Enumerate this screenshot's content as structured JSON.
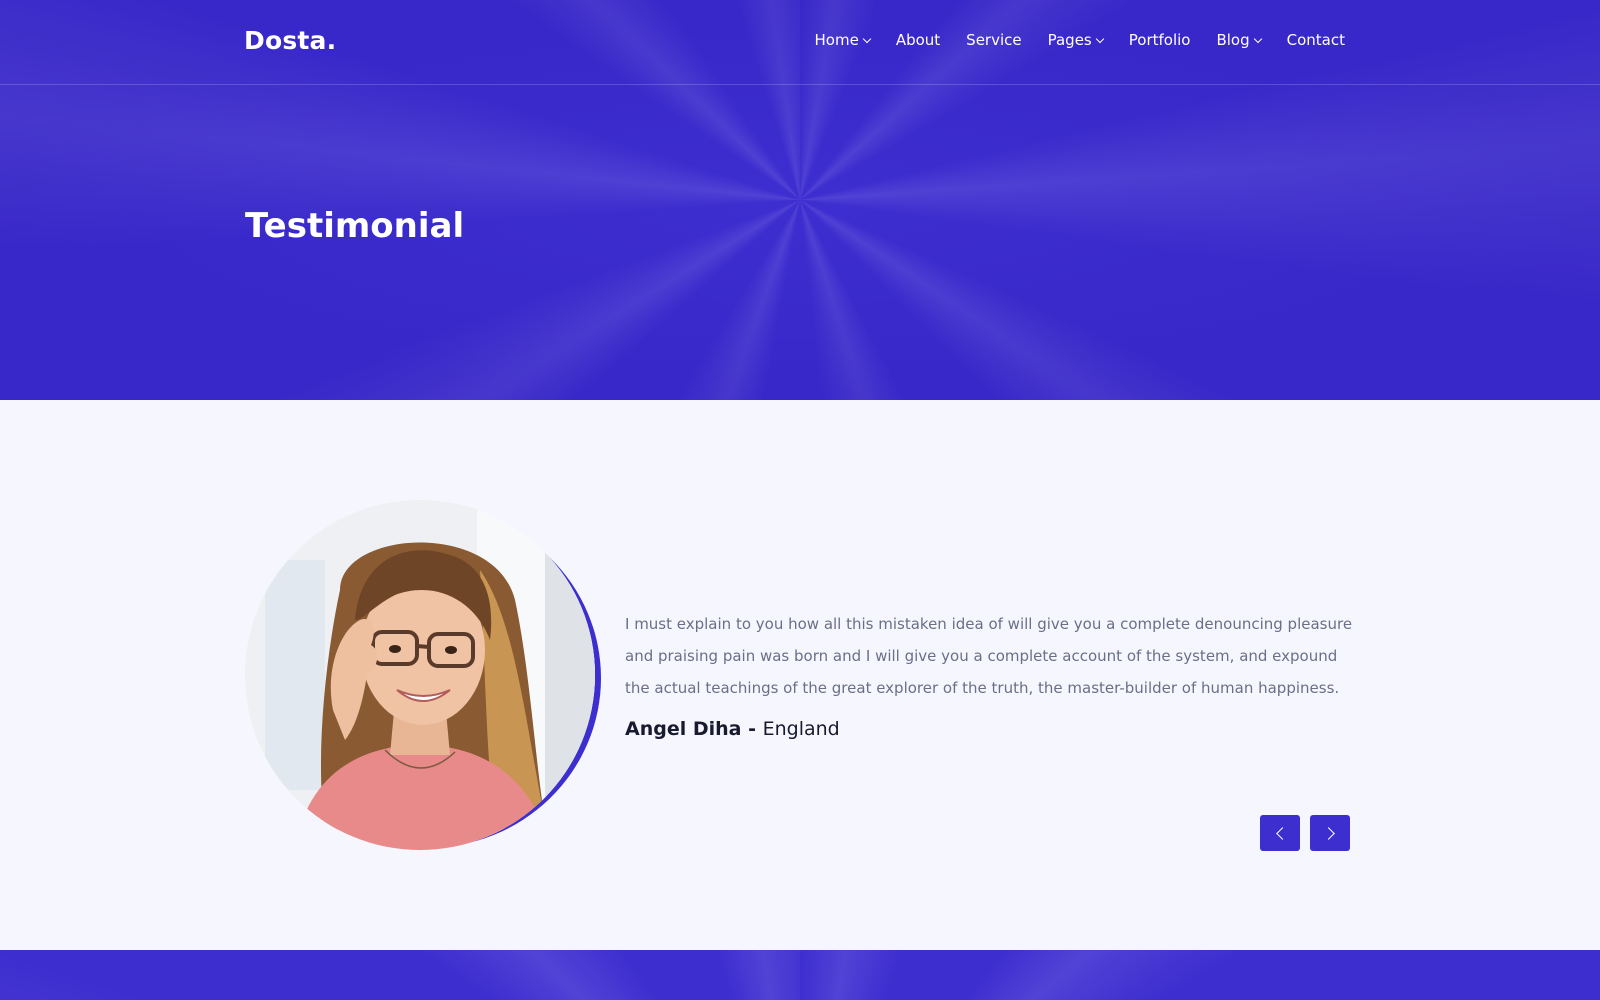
{
  "brand": {
    "logo": "Dosta."
  },
  "nav": {
    "items": [
      {
        "label": "Home",
        "has_dropdown": true
      },
      {
        "label": "About",
        "has_dropdown": false
      },
      {
        "label": "Service",
        "has_dropdown": false
      },
      {
        "label": "Pages",
        "has_dropdown": true
      },
      {
        "label": "Portfolio",
        "has_dropdown": false
      },
      {
        "label": "Blog",
        "has_dropdown": true
      },
      {
        "label": "Contact",
        "has_dropdown": false
      }
    ]
  },
  "hero": {
    "title": "Testimonial"
  },
  "testimonial": {
    "quote": "I must explain to you how all this mistaken idea of will give you a complete denouncing pleasure and praising pain was born and I will give you a complete account of the system, and expound the actual teachings of the great explorer of the truth, the master-builder of human happiness.",
    "author_name": "Angel Diha - ",
    "author_location": "England",
    "controls": {
      "prev_icon": "chevron-left-icon",
      "next_icon": "chevron-right-icon"
    }
  },
  "colors": {
    "primary": "#3d2ed0",
    "background": "#f6f7fe",
    "text_muted": "#6b6f86",
    "text_dark": "#1a1a2e"
  }
}
